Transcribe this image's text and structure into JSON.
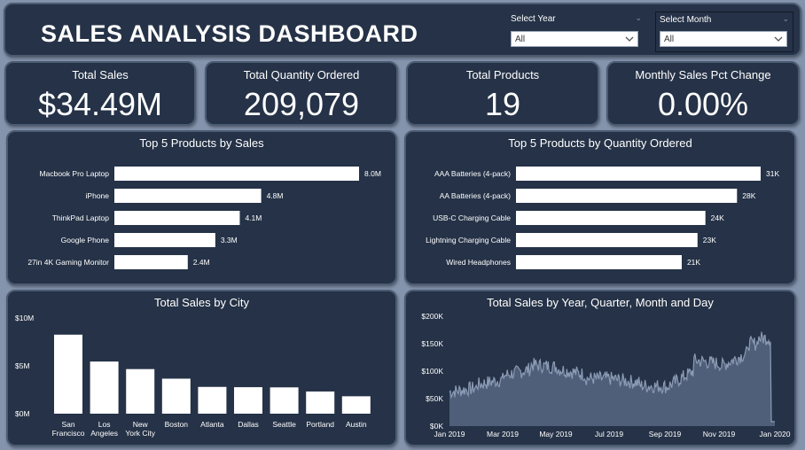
{
  "header": {
    "title": "SALES ANALYSIS DASHBOARD"
  },
  "slicers": {
    "year": {
      "label": "Select Year",
      "value": "All"
    },
    "month": {
      "label": "Select Month",
      "value": "All"
    }
  },
  "kpis": [
    {
      "title": "Total Sales",
      "value": "$34.49M"
    },
    {
      "title": "Total Quantity Ordered",
      "value": "209,079"
    },
    {
      "title": "Total Products",
      "value": "19"
    },
    {
      "title": "Monthly Sales Pct Change",
      "value": "0.00%"
    }
  ],
  "colors": {
    "panel": "#253247",
    "border": "#4b5b72",
    "background": "#8494ad",
    "bar": "#ffffff",
    "area": "#8b9bb4"
  },
  "chart_data": [
    {
      "type": "bar",
      "orientation": "horizontal",
      "title": "Top 5 Products by Sales",
      "categories": [
        "Macbook Pro Laptop",
        "iPhone",
        "ThinkPad Laptop",
        "Google Phone",
        "27in 4K Gaming Monitor"
      ],
      "values": [
        8.0,
        4.8,
        4.1,
        3.3,
        2.4
      ],
      "labels": [
        "8.0M",
        "4.8M",
        "4.1M",
        "3.3M",
        "2.4M"
      ]
    },
    {
      "type": "bar",
      "orientation": "horizontal",
      "title": "Top 5 Products by Quantity Ordered",
      "categories": [
        "AAA Batteries (4-pack)",
        "AA Batteries (4-pack)",
        "USB-C Charging Cable",
        "Lightning Charging Cable",
        "Wired Headphones"
      ],
      "values": [
        31,
        28,
        24,
        23,
        21
      ],
      "labels": [
        "31K",
        "28K",
        "24K",
        "23K",
        "21K"
      ]
    },
    {
      "type": "bar",
      "orientation": "vertical",
      "title": "Total Sales by City",
      "categories": [
        "San Francisco",
        "Los Angeles",
        "New York City",
        "Boston",
        "Atlanta",
        "Dallas",
        "Seattle",
        "Portland",
        "Austin"
      ],
      "values": [
        8.26,
        5.45,
        4.66,
        3.66,
        2.8,
        2.77,
        2.75,
        2.32,
        1.82
      ],
      "yticks": [
        "$0M",
        "$5M",
        "$10M"
      ],
      "ylim": [
        0,
        10
      ]
    },
    {
      "type": "area",
      "title": "Total Sales by Year, Quarter, Month and Day",
      "xticks": [
        "Jan 2019",
        "Mar 2019",
        "May 2019",
        "Jul 2019",
        "Sep 2019",
        "Nov 2019",
        "Jan 2020"
      ],
      "yticks": [
        "$0K",
        "$50K",
        "$100K",
        "$150K",
        "$200K"
      ],
      "ylim": [
        0,
        200
      ],
      "monthly_levels_k": [
        {
          "month": "Jan 2019",
          "level": 62
        },
        {
          "month": "Feb 2019",
          "level": 75
        },
        {
          "month": "Mar 2019",
          "level": 92
        },
        {
          "month": "Apr 2019",
          "level": 112
        },
        {
          "month": "May 2019",
          "level": 104
        },
        {
          "month": "Jun 2019",
          "level": 87
        },
        {
          "month": "Jul 2019",
          "level": 86
        },
        {
          "month": "Aug 2019",
          "level": 74
        },
        {
          "month": "Sep 2019",
          "level": 71
        },
        {
          "month": "Oct 2019",
          "level": 120
        },
        {
          "month": "Nov 2019",
          "level": 109
        },
        {
          "month": "Dec 2019",
          "level": 150
        },
        {
          "month": "Jan 2020",
          "level": 8
        }
      ]
    }
  ]
}
